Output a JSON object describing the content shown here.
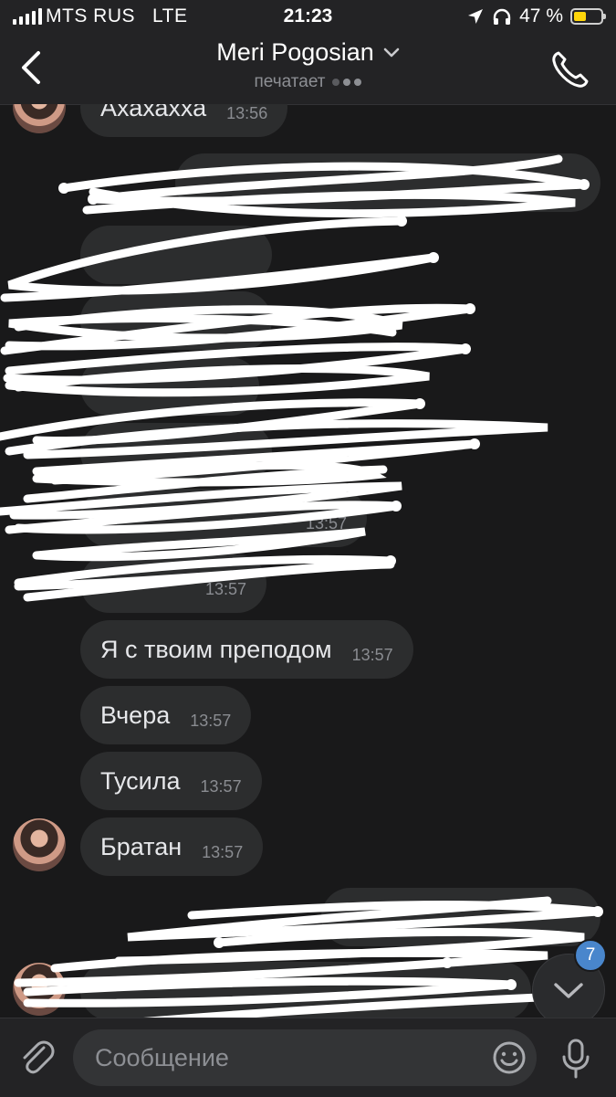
{
  "status_bar": {
    "carrier": "MTS RUS",
    "network": "LTE",
    "time": "21:23",
    "battery_percent_label": "47 %",
    "battery_level": 0.47
  },
  "header": {
    "name": "Meri Pogosian",
    "status": "печатает"
  },
  "messages": [
    {
      "text": "Ахахахха",
      "time": "13:56",
      "side": "in"
    },
    {
      "text": "",
      "time": "",
      "side": "out",
      "obscured": true
    },
    {
      "text": "",
      "time": "",
      "side": "in",
      "obscured": true
    },
    {
      "text": "",
      "time": "",
      "side": "in",
      "obscured": true
    },
    {
      "text": "",
      "time": "",
      "side": "in",
      "obscured": true
    },
    {
      "text": "",
      "time": "",
      "side": "in",
      "obscured": true
    },
    {
      "text": "",
      "time": "13:57",
      "side": "in",
      "obscured": true
    },
    {
      "text": "",
      "time": "13:57",
      "side": "in",
      "obscured": true
    },
    {
      "text": "Я с твоим преподом",
      "time": "13:57",
      "side": "in"
    },
    {
      "text": "Вчера",
      "time": "13:57",
      "side": "in"
    },
    {
      "text": "Тусила",
      "time": "13:57",
      "side": "in"
    },
    {
      "text": "Братан",
      "time": "13:57",
      "side": "in"
    },
    {
      "text": "",
      "time": "",
      "side": "out",
      "obscured": true
    },
    {
      "text": "",
      "time": "",
      "side": "in",
      "obscured": true
    }
  ],
  "scroll_down": {
    "unread_count": "7"
  },
  "composer": {
    "placeholder": "Сообщение"
  },
  "colors": {
    "background": "#19191a",
    "bubble": "#2c2d2e",
    "accent": "#4986cc",
    "battery": "#ffd60a"
  }
}
